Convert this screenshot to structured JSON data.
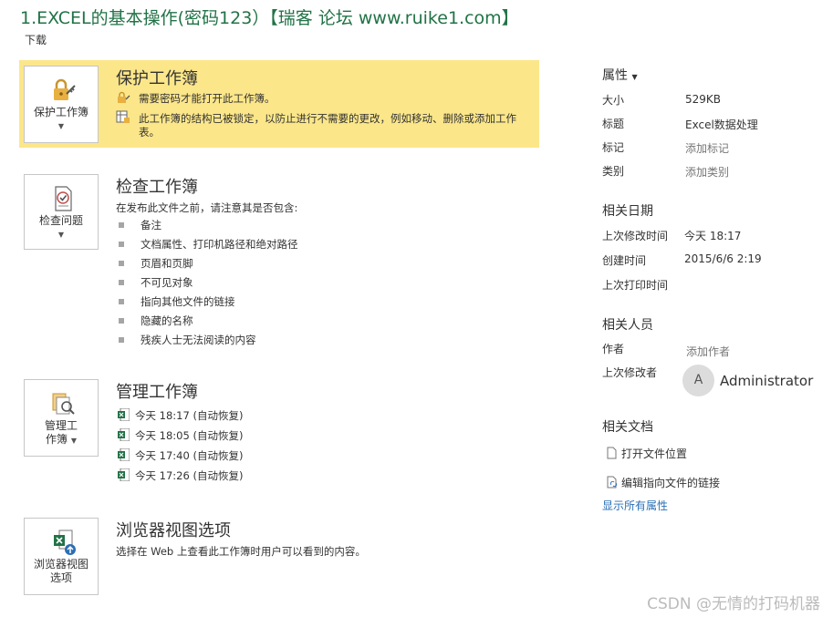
{
  "window": {
    "title": "1.EXCEL的基本操作(密码123）【瑞客 论坛 www.ruike1.com】",
    "download_label": "下载"
  },
  "protect": {
    "tile_label": "保护工作簿",
    "title": "保护工作簿",
    "line1": "需要密码才能打开此工作簿。",
    "line2a": "此工作簿的结构已被锁定，以防止进行不需要的更改，例如移动、删除或添加工作",
    "line2b": "表。"
  },
  "inspect": {
    "tile_label": "检查问题",
    "title": "检查工作簿",
    "desc": "在发布此文件之前，请注意其是否包含:",
    "items": [
      "备注",
      "文档属性、打印机路径和绝对路径",
      "页眉和页脚",
      "不可见对象",
      "指向其他文件的链接",
      "隐藏的名称",
      "残疾人士无法阅读的内容"
    ]
  },
  "manage": {
    "tile_line1": "管理工",
    "tile_line2": "作簿",
    "title": "管理工作簿",
    "versions": [
      "今天 18:17 (自动恢复)",
      "今天 18:05 (自动恢复)",
      "今天 17:40 (自动恢复)",
      "今天 17:26 (自动恢复)"
    ]
  },
  "browser": {
    "tile_line1": "浏览器视图",
    "tile_line2": "选项",
    "title": "浏览器视图选项",
    "desc": "选择在 Web 上查看此工作簿时用户可以看到的内容。"
  },
  "properties": {
    "heading": "属性",
    "rows": [
      {
        "label": "大小",
        "value": "529KB"
      },
      {
        "label": "标题",
        "value": "Excel数据处理"
      },
      {
        "label": "标记",
        "value": "添加标记"
      },
      {
        "label": "类别",
        "value": "添加类别"
      }
    ]
  },
  "dates": {
    "heading": "相关日期",
    "rows": [
      {
        "label": "上次修改时间",
        "value": "今天 18:17"
      },
      {
        "label": "创建时间",
        "value": "2015/6/6 2:19"
      },
      {
        "label": "上次打印时间",
        "value": ""
      }
    ]
  },
  "people": {
    "heading": "相关人员",
    "author_label": "作者",
    "author_value": "添加作者",
    "modifier_label": "上次修改者",
    "avatar_initial": "A",
    "modifier_name": "Administrator"
  },
  "docs": {
    "heading": "相关文档",
    "open_location": "打开文件位置",
    "edit_links": "编辑指向文件的链接",
    "show_all": "显示所有属性"
  },
  "watermark": "CSDN @无情的打码机器",
  "colors": {
    "accent": "#217346",
    "protect_bg": "#fbe68a",
    "link": "#2b6fb5"
  }
}
